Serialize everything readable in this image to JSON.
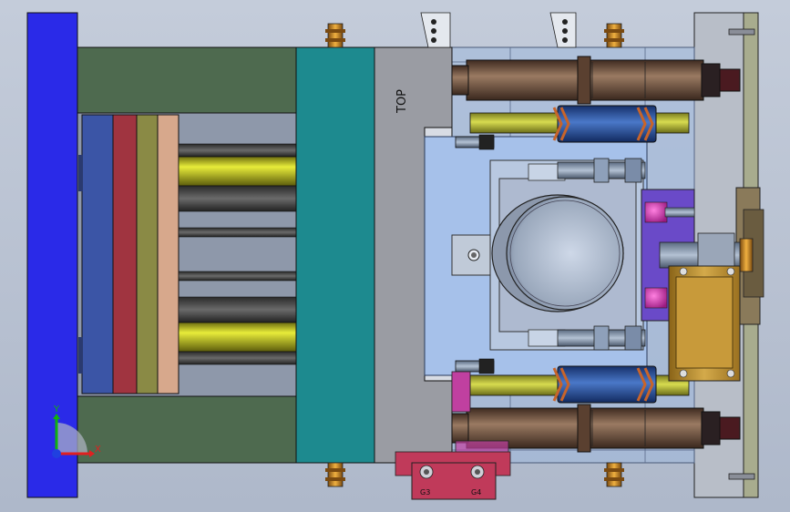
{
  "labels": {
    "top": "TOP",
    "g3": "G3",
    "g4": "G4"
  },
  "triad": {
    "x_label": "X",
    "y_label": "Y",
    "x_color": "#e02020",
    "y_color": "#10b010",
    "z_color": "#2040e0"
  },
  "colors": {
    "background": "#b9c2d2",
    "clamp_plate_blue": "#2a2ae8",
    "support_green": "#4e6a4f",
    "cavity_teal": "#1d8a8f",
    "stripper_gray": "#9a9ca3",
    "insert_light_blue": "#a6c1ea",
    "ejector_blue": "#3b55a6",
    "ejector_red": "#a03440",
    "ejector_olive": "#8a8a45",
    "ejector_tan": "#d7a88c",
    "guide_brown": "#7a5a48",
    "pin_yellow": "#c8cc2a",
    "coil_blue": "#2a5aa8",
    "slide_gold": "#c8a040",
    "magenta": "#c040a0",
    "gate_red": "#c03a5a"
  }
}
